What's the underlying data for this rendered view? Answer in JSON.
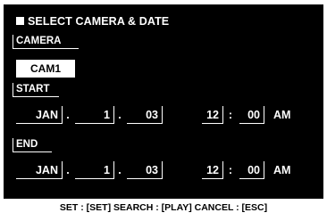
{
  "title": "SELECT CAMERA & DATE",
  "camera": {
    "section_label": "CAMERA",
    "selected": "CAM1"
  },
  "start": {
    "section_label": "START",
    "month": "JAN",
    "day": "1",
    "year": "03",
    "hour": "12",
    "minute": "00",
    "ampm": "AM"
  },
  "end": {
    "section_label": "END",
    "month": "JAN",
    "day": "1",
    "year": "03",
    "hour": "12",
    "minute": "00",
    "ampm": "AM"
  },
  "separators": {
    "date": ".",
    "time": ":"
  },
  "footer": "SET : [SET]   SEARCH : [PLAY]   CANCEL : [ESC]",
  "colors": {
    "background": "#000000",
    "foreground": "#ffffff",
    "highlight": "#ffffff"
  }
}
